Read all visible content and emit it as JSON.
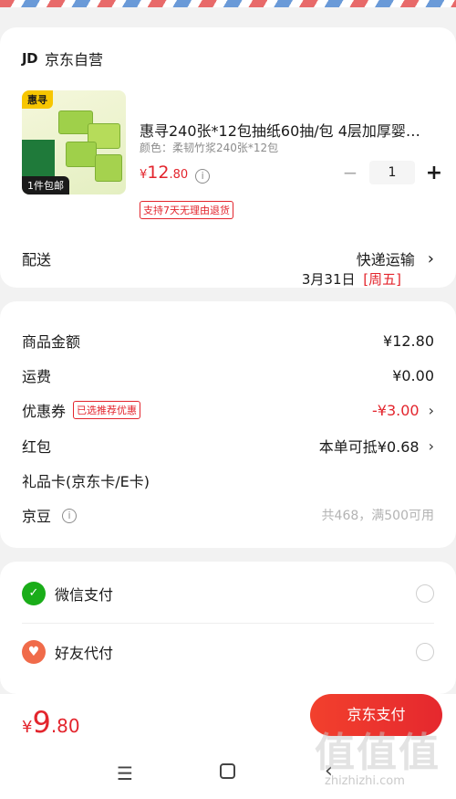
{
  "shop": {
    "logo_text": "JD",
    "name": "京东自营"
  },
  "product": {
    "thumb_brand_tag": "惠寻",
    "thumb_free_ship": "1件包邮",
    "title": "惠寻240张*12包抽纸60抽/包 4层加厚婴…",
    "spec": "颜色：柔韧竹浆240张*12包",
    "price_currency": "¥",
    "price_int": "12",
    "price_dec": ".80",
    "info_icon_glyph": "i",
    "quantity": "1",
    "minus_glyph": "−",
    "plus_glyph": "+",
    "return_policy": "支持7天无理由退货"
  },
  "shipping": {
    "label": "配送",
    "method": "快递运输",
    "chevron": "›",
    "date": "3月31日",
    "weekday": "[周五]"
  },
  "price_summary": {
    "rows": [
      {
        "label": "商品金额",
        "value": "¥12.80"
      },
      {
        "label": "运费",
        "value": "¥0.00"
      },
      {
        "label": "优惠券",
        "badge": "已选推荐优惠",
        "value": "-¥3.00",
        "chevron": "›"
      },
      {
        "label": "红包",
        "value": "本单可抵¥0.68",
        "chevron": "›"
      },
      {
        "label": "礼品卡(京东卡/E卡)",
        "value": ""
      },
      {
        "label": "京豆",
        "info_glyph": "i",
        "value": "共468，满500可用"
      }
    ]
  },
  "payment": {
    "options": [
      {
        "label": "微信支付",
        "icon": "wechat-icon",
        "icon_glyph": "✓"
      },
      {
        "label": "好友代付",
        "icon": "friend-pay-icon",
        "icon_glyph": "♥"
      }
    ]
  },
  "checkout": {
    "currency": "¥",
    "total_int": "9",
    "total_dec": ".80",
    "pay_button": "京东支付"
  },
  "system_nav": {
    "menu_glyph": "☰",
    "back_glyph": "‹"
  },
  "watermark": {
    "text": "值值值",
    "url": "zhizhizhi.com"
  },
  "colors": {
    "accent_red": "#e3252d",
    "wechat_green": "#1aad19"
  }
}
